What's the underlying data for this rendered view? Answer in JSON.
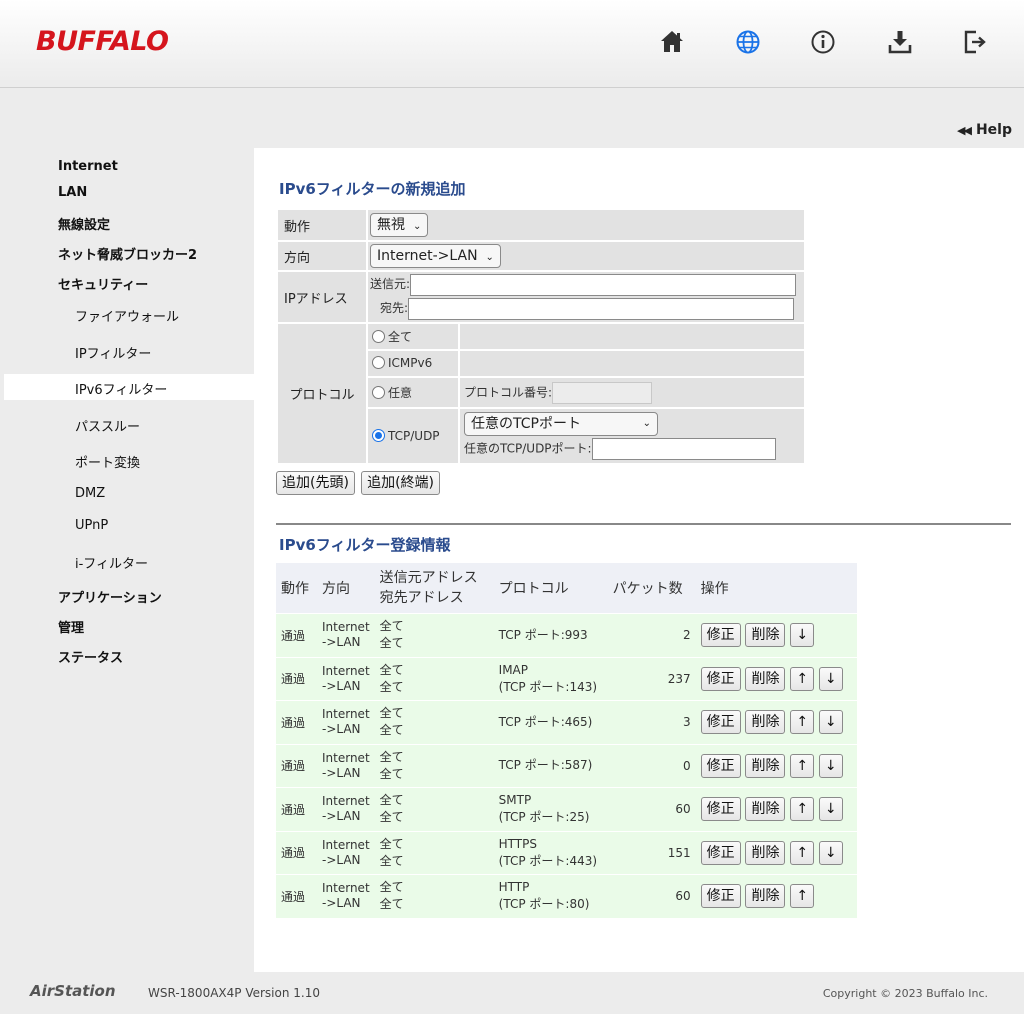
{
  "brand": {
    "logo": "BUFFALO",
    "footer_brand": "AirStation",
    "version": "WSR-1800AX4P Version 1.10",
    "copyright": "Copyright © 2023 Buffalo Inc.",
    "accent": "#d5151d"
  },
  "header_icons": [
    "home-icon",
    "globe-icon",
    "info-icon",
    "download-icon",
    "logout-icon"
  ],
  "help": {
    "label": "Help",
    "arrows": "◀◀"
  },
  "sidebar": {
    "items": [
      {
        "label": "Internet",
        "level": "top"
      },
      {
        "label": "LAN",
        "level": "top"
      },
      {
        "label": "無線設定",
        "level": "top"
      },
      {
        "label": "ネット脅威ブロッカー2",
        "level": "top"
      },
      {
        "label": "セキュリティー",
        "level": "top"
      },
      {
        "label": "ファイアウォール",
        "level": "sub"
      },
      {
        "label": "IPフィルター",
        "level": "sub"
      },
      {
        "label": "IPv6フィルター",
        "level": "sub",
        "active": true
      },
      {
        "label": "パススルー",
        "level": "sub"
      },
      {
        "label": "ポート変換",
        "level": "sub"
      },
      {
        "label": "DMZ",
        "level": "sub"
      },
      {
        "label": "UPnP",
        "level": "sub"
      },
      {
        "label": "i-フィルター",
        "level": "sub"
      },
      {
        "label": "アプリケーション",
        "level": "top"
      },
      {
        "label": "管理",
        "level": "top"
      },
      {
        "label": "ステータス",
        "level": "top"
      }
    ]
  },
  "add_form": {
    "title": "IPv6フィルターの新規追加",
    "action_label": "動作",
    "action_value": "無視",
    "direction_label": "方向",
    "direction_value": "Internet->LAN",
    "ip_label": "IPアドレス",
    "src_label": "送信元:",
    "dst_label": "宛先:",
    "protocol_label": "プロトコル",
    "proto_all": "全て",
    "proto_icmpv6": "ICMPv6",
    "proto_any": "任意",
    "proto_number_label": "プロトコル番号:",
    "proto_tcpudp": "TCP/UDP",
    "tcp_port_select": "任意のTCPポート",
    "tcp_port_label": "任意のTCP/UDPポート:",
    "add_head": "追加(先頭)",
    "add_tail": "追加(終端)"
  },
  "registered": {
    "title": "IPv6フィルター登録情報",
    "headers": {
      "action": "動作",
      "direction": "方向",
      "src": "送信元アドレス",
      "dst": "宛先アドレス",
      "protocol": "プロトコル",
      "packets": "パケット数",
      "ops": "操作"
    },
    "buttons": {
      "edit": "修正",
      "delete": "削除",
      "up": "↑",
      "down": "↓"
    },
    "rows": [
      {
        "action": "通過",
        "dir1": "Internet",
        "dir2": "->LAN",
        "src": "全て",
        "dst": "全て",
        "proto1": "",
        "proto2": "TCP ポート:993",
        "packets": "2",
        "up": false,
        "down": true
      },
      {
        "action": "通過",
        "dir1": "Internet",
        "dir2": "->LAN",
        "src": "全て",
        "dst": "全て",
        "proto1": "IMAP",
        "proto2": "(TCP ポート:143)",
        "packets": "237",
        "up": true,
        "down": true
      },
      {
        "action": "通過",
        "dir1": "Internet",
        "dir2": "->LAN",
        "src": "全て",
        "dst": "全て",
        "proto1": "",
        "proto2": "TCP ポート:465)",
        "packets": "3",
        "up": true,
        "down": true
      },
      {
        "action": "通過",
        "dir1": "Internet",
        "dir2": "->LAN",
        "src": "全て",
        "dst": "全て",
        "proto1": "",
        "proto2": "TCP ポート:587)",
        "packets": "0",
        "up": true,
        "down": true
      },
      {
        "action": "通過",
        "dir1": "Internet",
        "dir2": "->LAN",
        "src": "全て",
        "dst": "全て",
        "proto1": "SMTP",
        "proto2": "(TCP ポート:25)",
        "packets": "60",
        "up": true,
        "down": true
      },
      {
        "action": "通過",
        "dir1": "Internet",
        "dir2": "->LAN",
        "src": "全て",
        "dst": "全て",
        "proto1": "HTTPS",
        "proto2": "(TCP ポート:443)",
        "packets": "151",
        "up": true,
        "down": true
      },
      {
        "action": "通過",
        "dir1": "Internet",
        "dir2": "->LAN",
        "src": "全て",
        "dst": "全て",
        "proto1": "HTTP",
        "proto2": "(TCP ポート:80)",
        "packets": "60",
        "up": true,
        "down": false
      }
    ]
  }
}
